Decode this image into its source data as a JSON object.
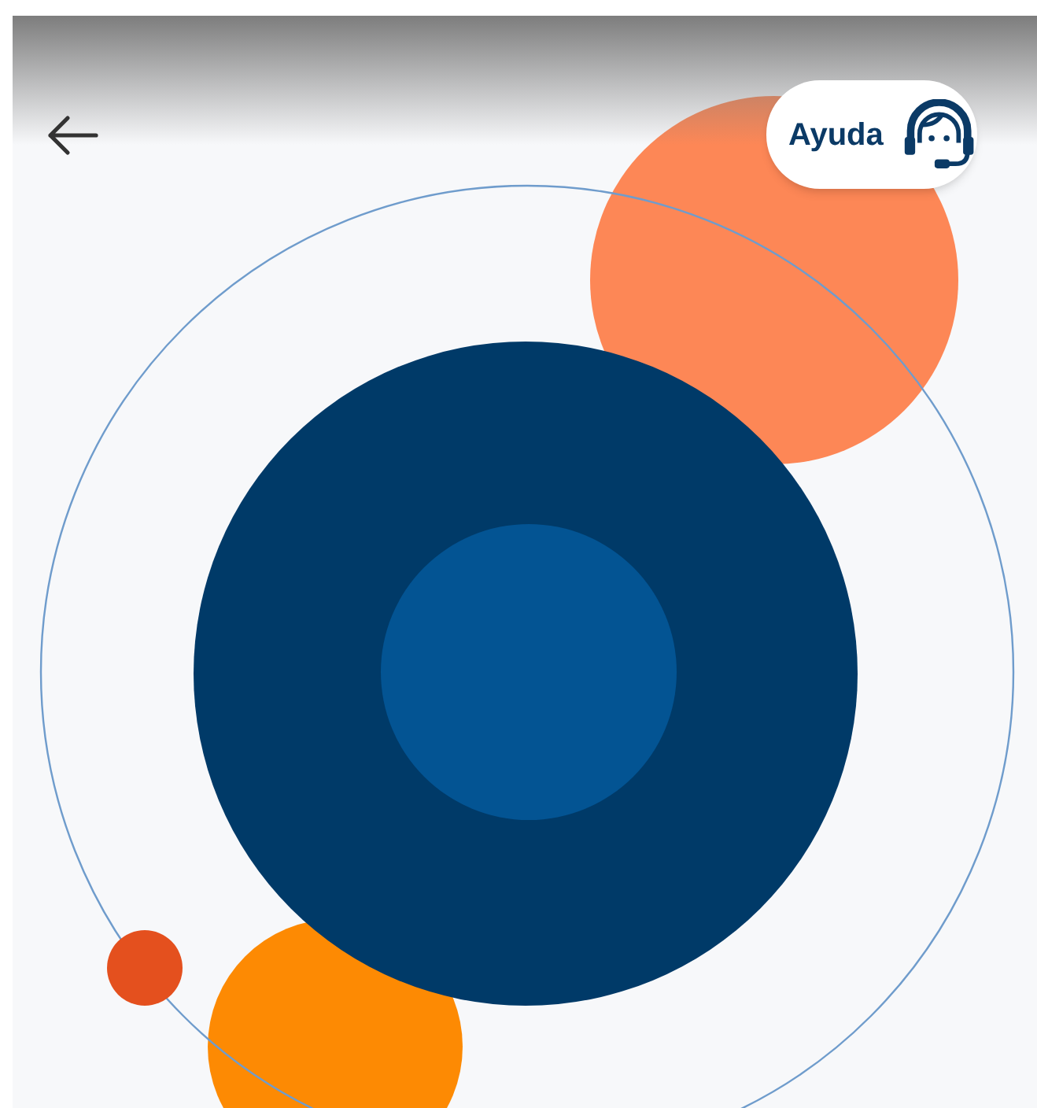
{
  "header": {
    "help_button": {
      "label": "Ayuda"
    }
  }
}
